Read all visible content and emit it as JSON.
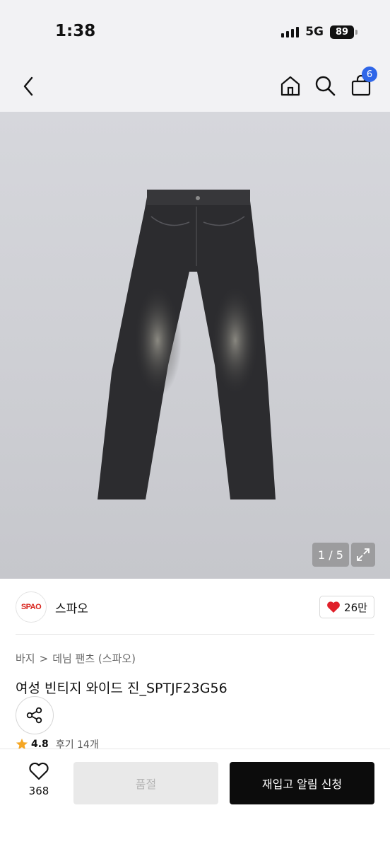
{
  "status_bar": {
    "time": "1:38",
    "network": "5G",
    "battery": "89"
  },
  "nav": {
    "cart_count": "6"
  },
  "gallery": {
    "counter": "1 / 5"
  },
  "brand": {
    "logo_text": "SPAO",
    "name": "스파오",
    "likes": "26만"
  },
  "breadcrumb": {
    "level1": "바지",
    "separator": ">",
    "level2": "데님 팬츠 (스파오)"
  },
  "product": {
    "title": "여성 빈티지 와이드 진_SPTJF23G56"
  },
  "rating": {
    "score": "4.8",
    "reviews": "후기 14개"
  },
  "bottom_bar": {
    "wish_count": "368",
    "soldout_label": "품절",
    "restock_label": "재입고 알림 신청"
  },
  "colors": {
    "accent_blue": "#2f66e8",
    "heart_red": "#e0202a",
    "star_orange": "#f5a623",
    "brand_red": "#d8241c"
  }
}
